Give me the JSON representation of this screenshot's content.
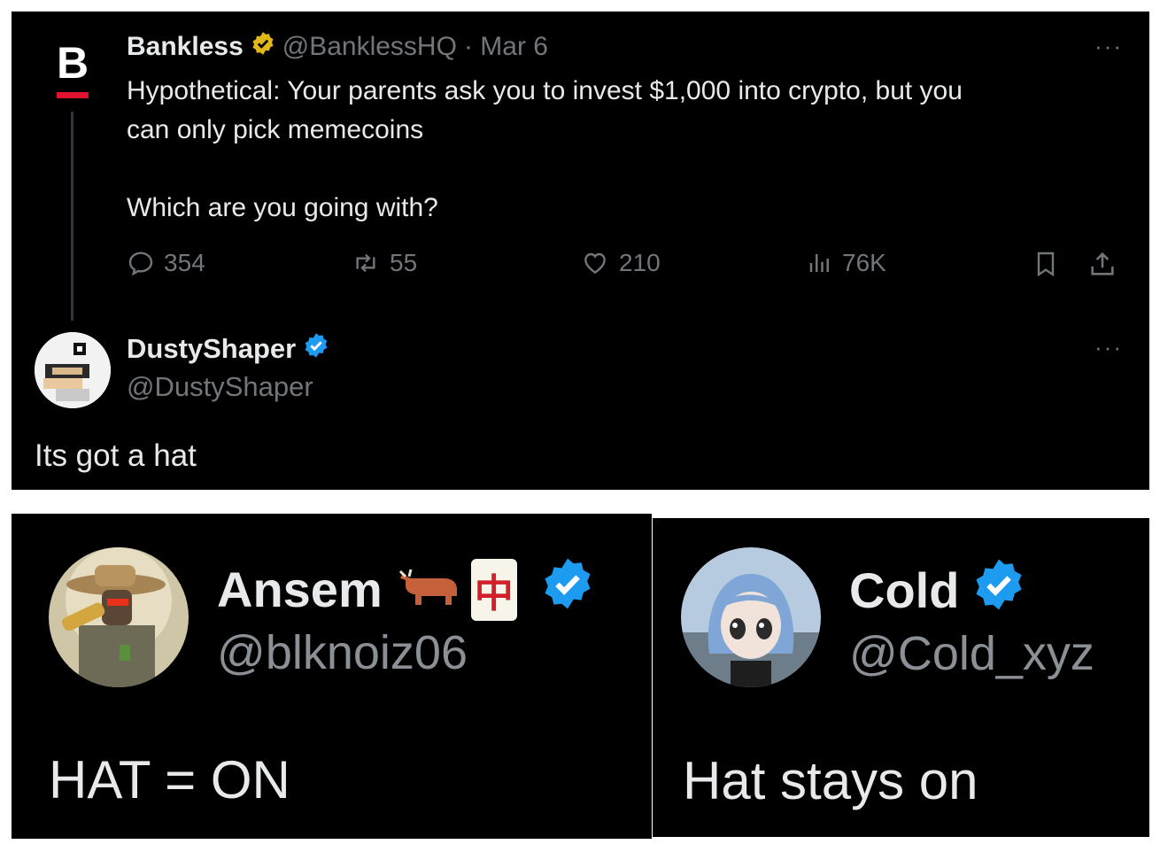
{
  "quoted_tweet": {
    "author_name": "Bankless",
    "author_handle": "@BanklessHQ",
    "date": "· Mar 6",
    "logo_letter": "B",
    "more": "···",
    "text": "Hypothetical: Your parents ask you to invest $1,000 into crypto, but you\ncan only pick memecoins\n\nWhich are you going with?",
    "stats": {
      "replies": "354",
      "reposts": "55",
      "likes": "210",
      "views": "76K"
    }
  },
  "reply": {
    "author_name": "DustyShaper",
    "author_handle": "@DustyShaper",
    "more": "···",
    "text": "Its got a hat"
  },
  "reply_ansem": {
    "author_name": "Ansem",
    "author_handle": "@blknoiz06",
    "emoji_badge": "中",
    "text": "HAT = ON"
  },
  "reply_cold": {
    "author_name": "Cold",
    "author_handle": "@Cold_xyz",
    "text": "Hat stays on"
  },
  "colors": {
    "background": "#000000",
    "text": "#e7e9ea",
    "muted": "#71767b",
    "verified_blue": "#1d9bf0",
    "gold": "#e2b719"
  }
}
